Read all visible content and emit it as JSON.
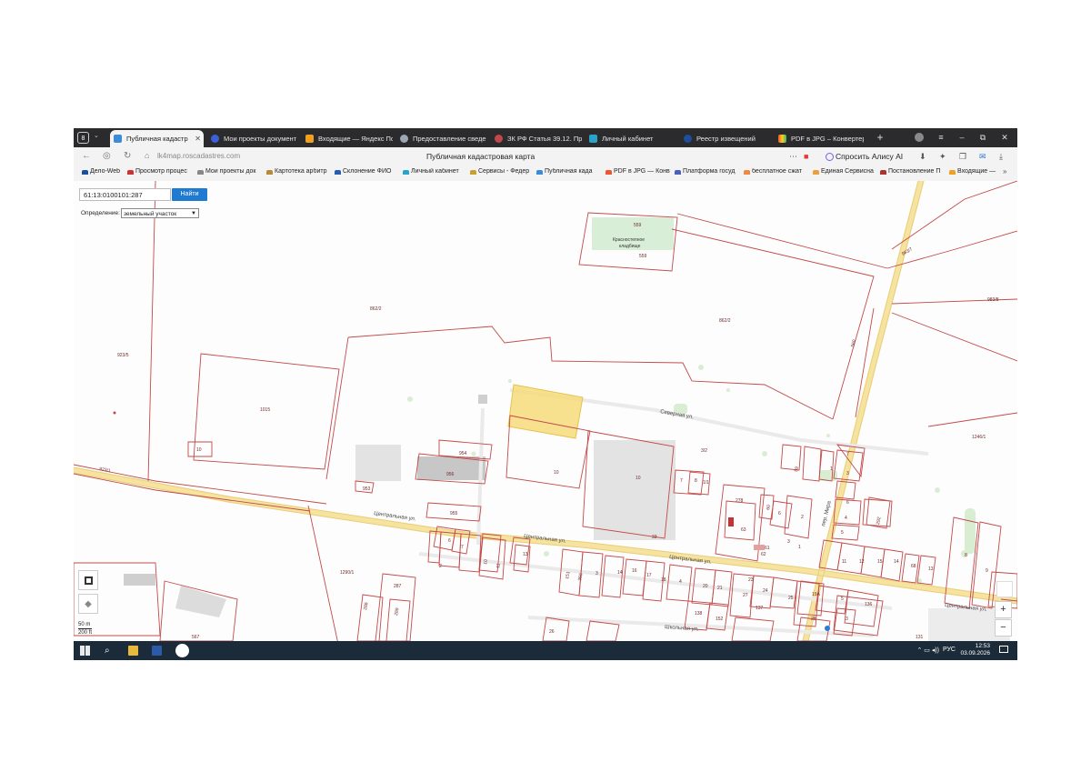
{
  "tabs": [
    {
      "label": "Публичная кадастр",
      "active": true
    },
    {
      "label": "Мои проекты документ"
    },
    {
      "label": "Входящие — Яндекс По"
    },
    {
      "label": "Предоставление сведе"
    },
    {
      "label": "ЗК РФ Статья 39.12. Про"
    },
    {
      "label": "Личный кабинет"
    },
    {
      "label": "Реестр извещений"
    },
    {
      "label": "PDF в JPG – Конвертер"
    }
  ],
  "tab_count": "8",
  "url": "lk4map.roscadastres.com",
  "page_title": "Публичная кадастровая карта",
  "alisa_label": "Спросить Алису AI",
  "bookmarks": [
    "Дело-Web",
    "Просмотр процес",
    "Мои проекты док",
    "Картотека арбитр",
    "Склонение ФИО",
    "Личный кабинет",
    "Сервисы - Федер",
    "Публичная када",
    "PDF в JPG — Конв",
    "Платформа госуд",
    "бесплатное сжат",
    "Единая Сервисна",
    "Постановление П",
    "Входящие —"
  ],
  "search": {
    "value": "61:13:0100101:287",
    "button": "Найти"
  },
  "definition": {
    "label": "Определение:",
    "value": "земельный участок"
  },
  "scale": {
    "metric": "50 m",
    "imperial": "200 ft"
  },
  "map_controls": {
    "zoom_in": "+",
    "zoom_out": "−"
  },
  "streets": [
    "Северная ул.",
    "Центральная ул.",
    "Центральная ул.",
    "Центральная ул.",
    "Центральная ул.",
    "Школьная ул.",
    "пер. Мира"
  ],
  "cemetery": {
    "number": "559",
    "name_line1": "Красностепное",
    "name_line2": "кладбище",
    "number_below": "559"
  },
  "parcels": [
    "862/2",
    "862/2",
    "923/5",
    "1015",
    "10",
    "923/1",
    "983/7",
    "983/8",
    "560",
    "1246/1",
    "954",
    "956",
    "953",
    "955",
    "10",
    "10",
    "7",
    "8",
    "278",
    "1290/1",
    "287",
    "288",
    "289",
    "33",
    "137",
    "136",
    "28",
    "19А",
    "26",
    "567",
    "131",
    "3",
    "5",
    "6",
    "7",
    "4",
    "2",
    "11",
    "10",
    "16",
    "17",
    "18",
    "20",
    "21",
    "22",
    "27",
    "24",
    "23",
    "25",
    "15",
    "14",
    "12",
    "151",
    "350",
    "2",
    "3",
    "9",
    "8",
    "13",
    "62",
    "61",
    "63",
    "59",
    "60",
    "292",
    "3/2",
    "1/1"
  ],
  "taskbar": {
    "lang": "РУС",
    "time": "12:53",
    "date": "03.09.2026"
  }
}
